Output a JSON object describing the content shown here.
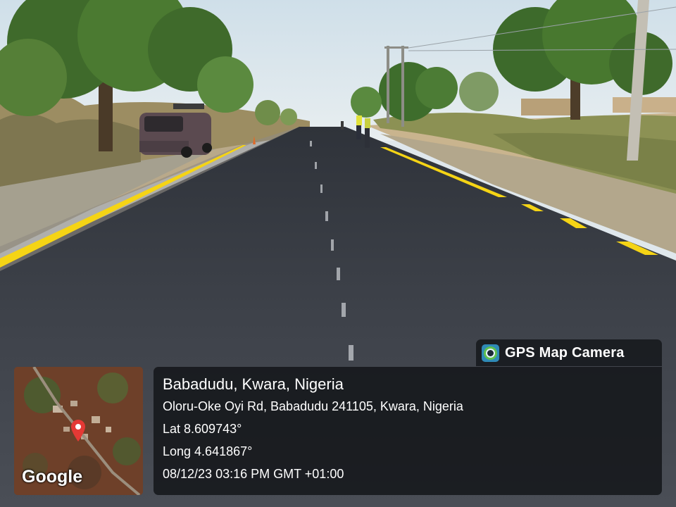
{
  "app": {
    "name": "GPS Map Camera",
    "icon": "gps-map-camera-logo-icon"
  },
  "map": {
    "brand": "Google",
    "pin_icon": "location-pin-icon"
  },
  "info": {
    "place": "Babadudu, Kwara, Nigeria",
    "address": "Oloru-Oke Oyi Rd, Babadudu 241105, Kwara, Nigeria",
    "lat": "Lat 8.609743°",
    "long": "Long 4.641867°",
    "datetime": "08/12/23 03:16 PM GMT +01:00"
  },
  "colors": {
    "lane_marking": "#f5d415",
    "asphalt": "#3b3f47",
    "sky": "#d7e4ec"
  }
}
